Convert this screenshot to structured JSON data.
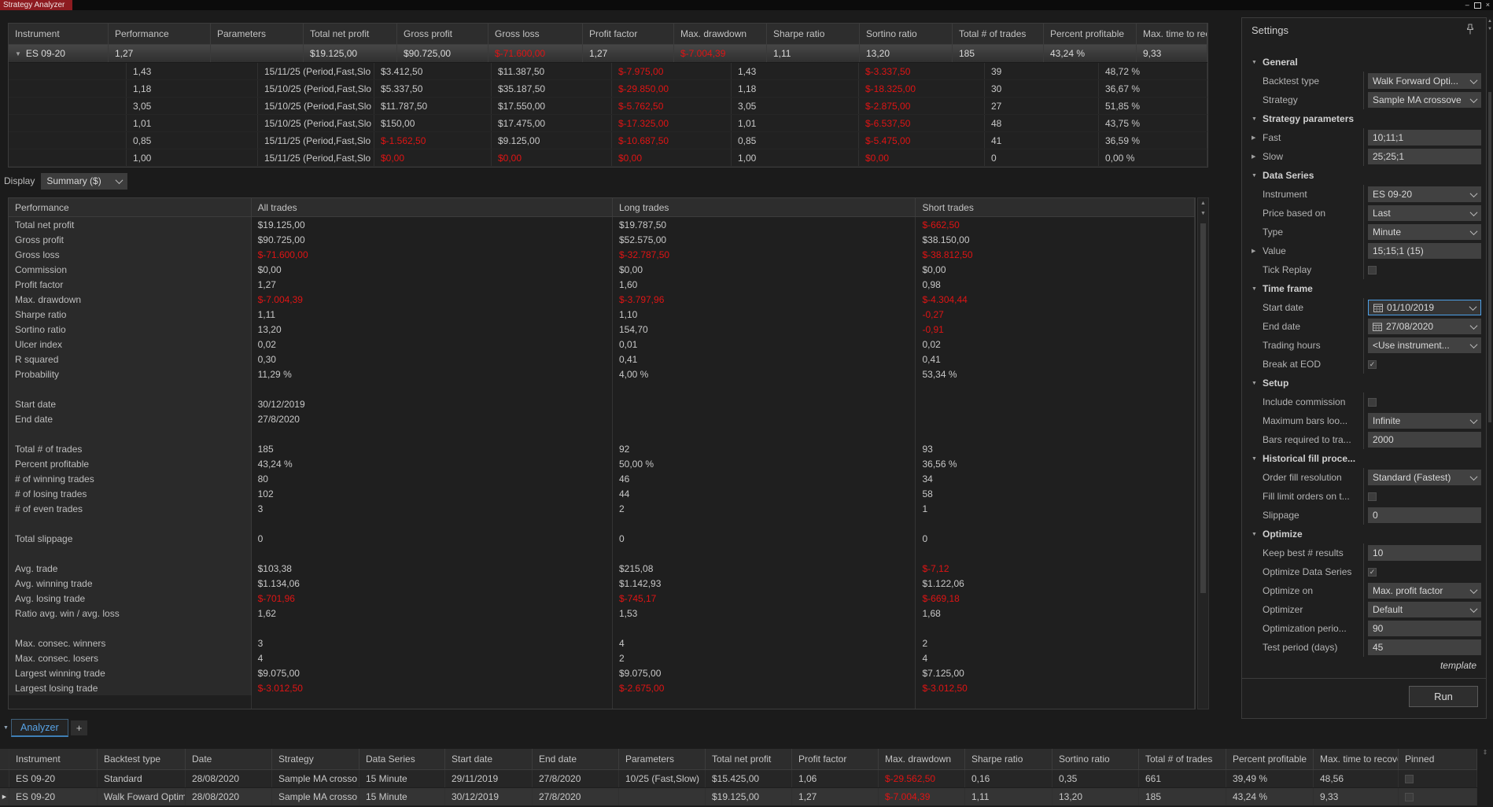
{
  "title_tab": "Strategy Analyzer",
  "icons": {
    "caret_down": "▼",
    "caret_right": "▶",
    "check": "✓",
    "minimize": "–",
    "close": "×",
    "updown": "▲▼"
  },
  "top_grid": {
    "columns": [
      "Instrument",
      "Performance",
      "Parameters",
      "Total net profit",
      "Gross profit",
      "Gross loss",
      "Profit factor",
      "Max. drawdown",
      "Sharpe ratio",
      "Sortino ratio",
      "Total # of trades",
      "Percent profitable",
      "Max. time to recover"
    ],
    "summary_row": {
      "instrument": "ES 09-20",
      "cells": [
        "1,27",
        "",
        "$19.125,00",
        "$90.725,00",
        [
          "$-71.600,00",
          "r"
        ],
        "1,27",
        [
          "$-7.004,39",
          "r"
        ],
        "1,11",
        "13,20",
        "185",
        "43,24 %",
        "9,33"
      ]
    },
    "sub_rows": [
      [
        "1,43",
        "15/11/25 (Period,Fast,Slo",
        "$3.412,50",
        "$11.387,50",
        [
          "$-7.975,00",
          "r"
        ],
        "1,43",
        [
          "$-3.337,50",
          "r"
        ],
        "39",
        "48,72 %"
      ],
      [
        "1,18",
        "15/10/25 (Period,Fast,Slo",
        "$5.337,50",
        "$35.187,50",
        [
          "$-29.850,00",
          "r"
        ],
        "1,18",
        [
          "$-18.325,00",
          "r"
        ],
        "30",
        "36,67 %"
      ],
      [
        "3,05",
        "15/10/25 (Period,Fast,Slo",
        "$11.787,50",
        "$17.550,00",
        [
          "$-5.762,50",
          "r"
        ],
        "3,05",
        [
          "$-2.875,00",
          "r"
        ],
        "27",
        "51,85 %"
      ],
      [
        "1,01",
        "15/10/25 (Period,Fast,Slo",
        "$150,00",
        "$17.475,00",
        [
          "$-17.325,00",
          "r"
        ],
        "1,01",
        [
          "$-6.537,50",
          "r"
        ],
        "48",
        "43,75 %"
      ],
      [
        "0,85",
        "15/11/25 (Period,Fast,Slo",
        [
          "$-1.562,50",
          "r"
        ],
        "$9.125,00",
        [
          "$-10.687,50",
          "r"
        ],
        "0,85",
        [
          "$-5.475,00",
          "r"
        ],
        "41",
        "36,59 %"
      ],
      [
        "1,00",
        "15/11/25 (Period,Fast,Slo",
        [
          "$0,00",
          "r"
        ],
        [
          "$0,00",
          "r"
        ],
        [
          "$0,00",
          "r"
        ],
        "1,00",
        [
          "$0,00",
          "r"
        ],
        "0",
        "0,00 %"
      ]
    ]
  },
  "display": {
    "label": "Display",
    "value": "Summary ($)"
  },
  "performance_grid": {
    "columns": [
      "Performance",
      "All trades",
      "Long trades",
      "Short trades"
    ],
    "rows": [
      [
        "Total net profit",
        "$19.125,00",
        "$19.787,50",
        [
          "$-662,50",
          "r"
        ]
      ],
      [
        "Gross profit",
        "$90.725,00",
        "$52.575,00",
        "$38.150,00"
      ],
      [
        "Gross loss",
        [
          "$-71.600,00",
          "r"
        ],
        [
          "$-32.787,50",
          "r"
        ],
        [
          "$-38.812,50",
          "r"
        ]
      ],
      [
        "Commission",
        "$0,00",
        "$0,00",
        "$0,00"
      ],
      [
        "Profit factor",
        "1,27",
        "1,60",
        "0,98"
      ],
      [
        "Max. drawdown",
        [
          "$-7.004,39",
          "r"
        ],
        [
          "$-3.797,96",
          "r"
        ],
        [
          "$-4.304,44",
          "r"
        ]
      ],
      [
        "Sharpe ratio",
        "1,11",
        "1,10",
        [
          "-0,27",
          "r"
        ]
      ],
      [
        "Sortino ratio",
        "13,20",
        "154,70",
        [
          "-0,91",
          "r"
        ]
      ],
      [
        "Ulcer index",
        "0,02",
        "0,01",
        "0,02"
      ],
      [
        "R squared",
        "0,30",
        "0,41",
        "0,41"
      ],
      [
        "Probability",
        "11,29 %",
        "4,00 %",
        "53,34 %"
      ],
      [
        "",
        "",
        "",
        ""
      ],
      [
        "Start date",
        "30/12/2019",
        "",
        ""
      ],
      [
        "End date",
        "27/8/2020",
        "",
        ""
      ],
      [
        "",
        "",
        "",
        ""
      ],
      [
        "Total # of trades",
        "185",
        "92",
        "93"
      ],
      [
        "Percent profitable",
        "43,24 %",
        "50,00 %",
        "36,56 %"
      ],
      [
        "# of winning trades",
        "80",
        "46",
        "34"
      ],
      [
        "# of losing trades",
        "102",
        "44",
        "58"
      ],
      [
        "# of even trades",
        "3",
        "2",
        "1"
      ],
      [
        "",
        "",
        "",
        ""
      ],
      [
        "Total slippage",
        "0",
        "0",
        "0"
      ],
      [
        "",
        "",
        "",
        ""
      ],
      [
        "Avg. trade",
        "$103,38",
        "$215,08",
        [
          "$-7,12",
          "r"
        ]
      ],
      [
        "Avg. winning trade",
        "$1.134,06",
        "$1.142,93",
        "$1.122,06"
      ],
      [
        "Avg. losing trade",
        [
          "$-701,96",
          "r"
        ],
        [
          "$-745,17",
          "r"
        ],
        [
          "$-669,18",
          "r"
        ]
      ],
      [
        "Ratio avg. win / avg. loss",
        "1,62",
        "1,53",
        "1,68"
      ],
      [
        "",
        "",
        "",
        ""
      ],
      [
        "Max. consec. winners",
        "3",
        "4",
        "2"
      ],
      [
        "Max. consec. losers",
        "4",
        "2",
        "4"
      ],
      [
        "Largest winning trade",
        "$9.075,00",
        "$9.075,00",
        "$7.125,00"
      ],
      [
        "Largest losing trade",
        [
          "$-3.012,50",
          "r"
        ],
        [
          "$-2.675,00",
          "r"
        ],
        [
          "$-3.012,50",
          "r"
        ]
      ]
    ]
  },
  "tabs": {
    "active": "Analyzer",
    "add": "+"
  },
  "bottom_grid": {
    "columns": [
      "Instrument",
      "Backtest type",
      "Date",
      "Strategy",
      "Data Series",
      "Start date",
      "End date",
      "Parameters",
      "Total net profit",
      "Profit factor",
      "Max. drawdown",
      "Sharpe ratio",
      "Sortino ratio",
      "Total # of trades",
      "Percent profitable",
      "Max. time to recove",
      "Pinned"
    ],
    "rows": [
      {
        "selected": false,
        "pinned": false,
        "cells": [
          "ES 09-20",
          "Standard",
          "28/08/2020",
          "Sample MA crosso",
          "15 Minute",
          "29/11/2019",
          "27/8/2020",
          "10/25 (Fast,Slow)",
          "$15.425,00",
          "1,06",
          [
            "$-29.562,50",
            "r"
          ],
          "0,16",
          "0,35",
          "661",
          "39,49 %",
          "48,56"
        ]
      },
      {
        "selected": true,
        "pinned": false,
        "cells": [
          "ES 09-20",
          "Walk Foward Optim",
          "28/08/2020",
          "Sample MA crosso",
          "15 Minute",
          "30/12/2019",
          "27/8/2020",
          "",
          "$19.125,00",
          "1,27",
          [
            "$-7.004,39",
            "r"
          ],
          "1,11",
          "13,20",
          "185",
          "43,24 %",
          "9,33"
        ]
      }
    ]
  },
  "settings": {
    "title": "Settings",
    "template_link": "template",
    "run_label": "Run",
    "rows": [
      {
        "k": "sec",
        "label": "General"
      },
      {
        "k": "dd",
        "label": "Backtest type",
        "value": "Walk Forward Opti..."
      },
      {
        "k": "dd",
        "label": "Strategy",
        "value": "Sample MA crossove"
      },
      {
        "k": "sec",
        "label": "Strategy parameters"
      },
      {
        "k": "inp",
        "label": "Fast",
        "value": "10;11;1",
        "exp": true
      },
      {
        "k": "inp",
        "label": "Slow",
        "value": "25;25;1",
        "exp": true
      },
      {
        "k": "sec",
        "label": "Data Series"
      },
      {
        "k": "dd",
        "label": "Instrument",
        "value": "ES 09-20"
      },
      {
        "k": "dd",
        "label": "Price based on",
        "value": "Last"
      },
      {
        "k": "dd",
        "label": "Type",
        "value": "Minute"
      },
      {
        "k": "inp",
        "label": "Value",
        "value": "15;15;1 (15)",
        "exp": true
      },
      {
        "k": "cb",
        "label": "Tick Replay",
        "checked": false
      },
      {
        "k": "sec",
        "label": "Time frame"
      },
      {
        "k": "date",
        "label": "Start date",
        "value": "01/10/2019",
        "focused": true
      },
      {
        "k": "date",
        "label": "End date",
        "value": "27/08/2020"
      },
      {
        "k": "dd",
        "label": "Trading hours",
        "value": "<Use instrument..."
      },
      {
        "k": "cb",
        "label": "Break at EOD",
        "checked": true
      },
      {
        "k": "sec",
        "label": "Setup"
      },
      {
        "k": "cb",
        "label": "Include commission",
        "checked": false
      },
      {
        "k": "dd",
        "label": "Maximum bars loo...",
        "value": "Infinite"
      },
      {
        "k": "inp",
        "label": "Bars required to tra...",
        "value": "2000"
      },
      {
        "k": "sec",
        "label": "Historical fill proce..."
      },
      {
        "k": "dd",
        "label": "Order fill resolution",
        "value": "Standard (Fastest)"
      },
      {
        "k": "cb",
        "label": "Fill limit orders on t...",
        "checked": false
      },
      {
        "k": "inp",
        "label": "Slippage",
        "value": "0"
      },
      {
        "k": "sec",
        "label": "Optimize"
      },
      {
        "k": "inp",
        "label": "Keep best # results",
        "value": "10"
      },
      {
        "k": "cb",
        "label": "Optimize Data Series",
        "checked": true
      },
      {
        "k": "dd",
        "label": "Optimize on",
        "value": "Max. profit factor"
      },
      {
        "k": "dd",
        "label": "Optimizer",
        "value": "Default"
      },
      {
        "k": "inp",
        "label": "Optimization perio...",
        "value": "90"
      },
      {
        "k": "inp",
        "label": "Test period (days)",
        "value": "45"
      }
    ]
  }
}
